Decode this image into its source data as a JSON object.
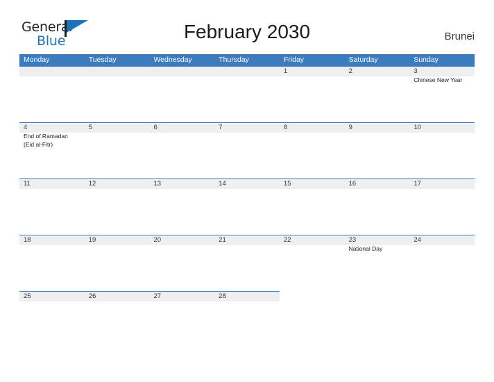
{
  "brand": {
    "name_part1": "General",
    "name_part2": "Blue",
    "flag_icon": "flag-icon"
  },
  "header": {
    "title": "February 2030",
    "country": "Brunei"
  },
  "colors": {
    "header_blue": "#3b7cbe",
    "band_gray": "#efefef",
    "logo_blue": "#1d72b8",
    "text_dark": "#231f20"
  },
  "calendar": {
    "weekdays": [
      "Monday",
      "Tuesday",
      "Wednesday",
      "Thursday",
      "Friday",
      "Saturday",
      "Sunday"
    ],
    "weeks": [
      {
        "band_span": 7,
        "days": [
          {
            "num": "",
            "events": []
          },
          {
            "num": "",
            "events": []
          },
          {
            "num": "",
            "events": []
          },
          {
            "num": "",
            "events": []
          },
          {
            "num": "1",
            "events": []
          },
          {
            "num": "2",
            "events": []
          },
          {
            "num": "3",
            "events": [
              "Chinese New Year"
            ]
          }
        ]
      },
      {
        "band_span": 7,
        "days": [
          {
            "num": "4",
            "events": [
              "End of Ramadan",
              "(Eid al-Fitr)"
            ]
          },
          {
            "num": "5",
            "events": []
          },
          {
            "num": "6",
            "events": []
          },
          {
            "num": "7",
            "events": []
          },
          {
            "num": "8",
            "events": []
          },
          {
            "num": "9",
            "events": []
          },
          {
            "num": "10",
            "events": []
          }
        ]
      },
      {
        "band_span": 7,
        "days": [
          {
            "num": "11",
            "events": []
          },
          {
            "num": "12",
            "events": []
          },
          {
            "num": "13",
            "events": []
          },
          {
            "num": "14",
            "events": []
          },
          {
            "num": "15",
            "events": []
          },
          {
            "num": "16",
            "events": []
          },
          {
            "num": "17",
            "events": []
          }
        ]
      },
      {
        "band_span": 7,
        "days": [
          {
            "num": "18",
            "events": []
          },
          {
            "num": "19",
            "events": []
          },
          {
            "num": "20",
            "events": []
          },
          {
            "num": "21",
            "events": []
          },
          {
            "num": "22",
            "events": []
          },
          {
            "num": "23",
            "events": [
              "National Day"
            ]
          },
          {
            "num": "24",
            "events": []
          }
        ]
      },
      {
        "band_span": 7,
        "days": [
          {
            "num": "25",
            "events": []
          },
          {
            "num": "26",
            "events": []
          },
          {
            "num": "27",
            "events": []
          },
          {
            "num": "28",
            "events": []
          },
          {
            "num": "",
            "events": []
          },
          {
            "num": "",
            "events": []
          },
          {
            "num": "",
            "events": []
          }
        ]
      }
    ]
  }
}
